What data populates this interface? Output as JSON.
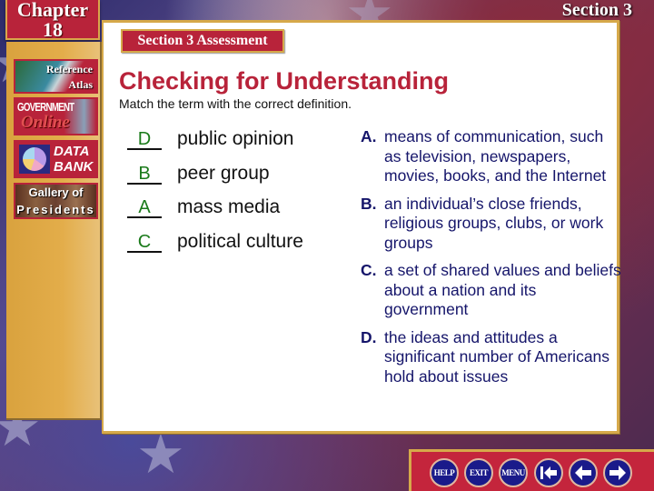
{
  "header": {
    "chapter_word": "Chapter",
    "chapter_number": "18",
    "section": "Section 3"
  },
  "sidebar": {
    "items": [
      {
        "name": "reference-atlas",
        "line1": "Reference",
        "line2": "Atlas"
      },
      {
        "name": "government-online",
        "line1": "GOVERNMENT",
        "line2": "Online"
      },
      {
        "name": "data-bank",
        "line1": "DATA",
        "line2": "BANK"
      },
      {
        "name": "gallery-of-presidents",
        "line1": "Gallery of",
        "line2": "Presidents"
      }
    ]
  },
  "main": {
    "section_tab": "Section 3 Assessment",
    "title": "Checking for Understanding",
    "instructions": "Match the term with the correct definition.",
    "terms": [
      {
        "answer": "D",
        "term": "public opinion"
      },
      {
        "answer": "B",
        "term": "peer group"
      },
      {
        "answer": "A",
        "term": "mass media"
      },
      {
        "answer": "C",
        "term": "political culture"
      }
    ],
    "definitions": [
      {
        "letter": "A.",
        "text": "means of communication, such as television, newspapers, movies, books, and the Internet"
      },
      {
        "letter": "B.",
        "text": "an individual’s close friends, religious groups, clubs, or work groups"
      },
      {
        "letter": "C.",
        "text": "a set of shared values and beliefs about a nation and its government"
      },
      {
        "letter": "D.",
        "text": "the ideas and attitudes a significant number of Americans hold about issues"
      }
    ]
  },
  "nav": {
    "help": "HELP",
    "exit": "EXIT",
    "menu": "MENU",
    "first_icon": "first-slide-arrow-icon",
    "back_icon": "back-arrow-icon",
    "next_icon": "next-arrow-icon"
  },
  "colors": {
    "accent_red": "#b8233a",
    "gold": "#d6a94a",
    "definition_blue": "#15156a",
    "answer_green": "#1a7a1a",
    "nav_blue": "#1a1a8a"
  }
}
